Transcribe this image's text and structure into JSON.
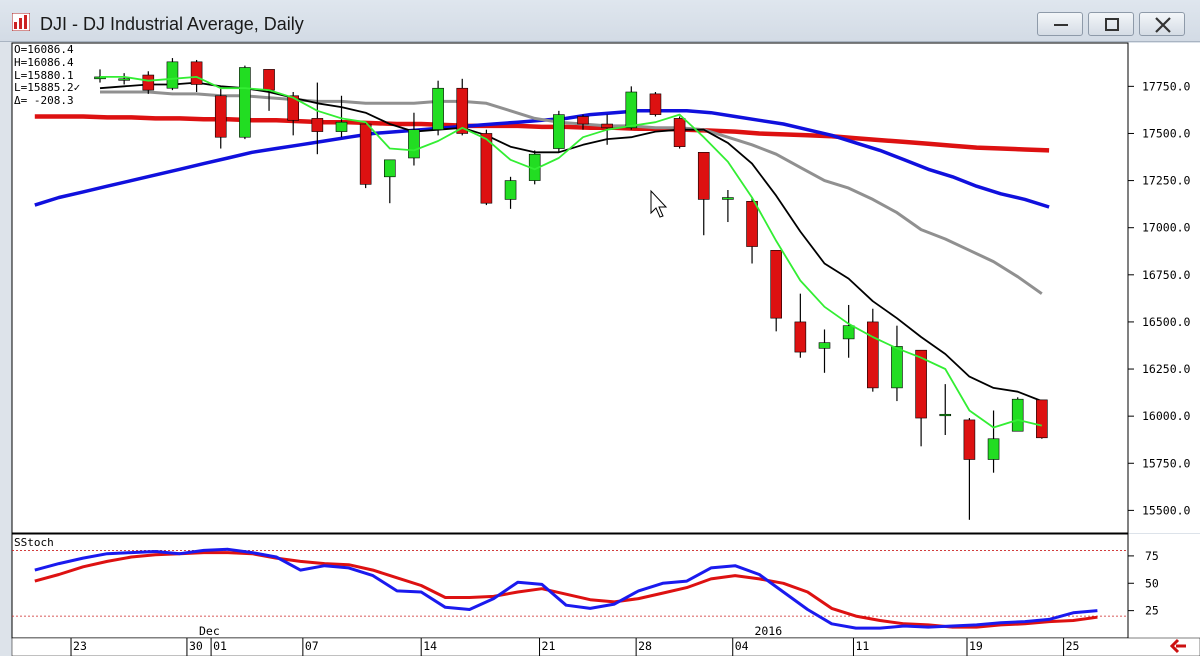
{
  "window": {
    "title": "DJI - DJ Industrial Average, Daily",
    "minimize_icon": "minimize-icon",
    "maximize_icon": "maximize-icon",
    "close_icon": "close-icon"
  },
  "ohlc_readout": {
    "open": "O=16086.4",
    "high": "H=16086.4",
    "low": "L=15880.1",
    "last": "L=15885.2",
    "last_mark": "✓",
    "delta": "Δ= -208.3"
  },
  "colors": {
    "up_candle": "#22dd22",
    "down_candle": "#dd1111",
    "ma_fast": "#33ee33",
    "ma_black": "#000000",
    "ma_gray": "#909090",
    "ma_blue": "#1010dd",
    "ma_red": "#dd1111",
    "stoch_k": "#1a1aee",
    "stoch_d": "#dd1111",
    "ref_line": "#cc2222"
  },
  "chart_data": [
    {
      "type": "candlestick",
      "title": "DJI - DJ Industrial Average, Daily",
      "price_axis": {
        "ylim": [
          15380,
          17980
        ],
        "ticks": [
          17750,
          17500,
          17250,
          17000,
          16750,
          16500,
          16250,
          16000,
          15750,
          15500
        ],
        "tick_labels": [
          "17750.0",
          "17500.0",
          "17250.0",
          "17000.0",
          "16750.0",
          "16500.0",
          "16250.0",
          "16000.0",
          "15750.0",
          "15500.0"
        ]
      },
      "date_axis": {
        "labels": [
          {
            "text": "23",
            "i": -1.2
          },
          {
            "text": "30",
            "i": 3.6
          },
          {
            "text": "01",
            "i": 4.6
          },
          {
            "text": "07",
            "i": 8.4
          },
          {
            "text": "14",
            "i": 13.3
          },
          {
            "text": "21",
            "i": 18.2
          },
          {
            "text": "28",
            "i": 22.2
          },
          {
            "text": "04",
            "i": 26.2
          },
          {
            "text": "11",
            "i": 31.2
          },
          {
            "text": "19",
            "i": 35.9
          },
          {
            "text": "25",
            "i": 39.9
          }
        ],
        "group_labels": [
          {
            "text": "Dec",
            "i": 4.1
          },
          {
            "text": "2016",
            "i": 27.1
          }
        ]
      },
      "candles": [
        {
          "o": 17790,
          "h": 17840,
          "l": 17770,
          "c": 17800
        },
        {
          "o": 17790,
          "h": 17820,
          "l": 17760,
          "c": 17790
        },
        {
          "o": 17810,
          "h": 17830,
          "l": 17710,
          "c": 17730
        },
        {
          "o": 17740,
          "h": 17900,
          "l": 17730,
          "c": 17880
        },
        {
          "o": 17880,
          "h": 17890,
          "l": 17720,
          "c": 17760
        },
        {
          "o": 17700,
          "h": 17750,
          "l": 17420,
          "c": 17480
        },
        {
          "o": 17480,
          "h": 17860,
          "l": 17470,
          "c": 17850
        },
        {
          "o": 17840,
          "h": 17840,
          "l": 17620,
          "c": 17730
        },
        {
          "o": 17700,
          "h": 17720,
          "l": 17490,
          "c": 17570
        },
        {
          "o": 17580,
          "h": 17770,
          "l": 17390,
          "c": 17510
        },
        {
          "o": 17510,
          "h": 17700,
          "l": 17480,
          "c": 17560
        },
        {
          "o": 17550,
          "h": 17560,
          "l": 17210,
          "c": 17230
        },
        {
          "o": 17270,
          "h": 17360,
          "l": 17130,
          "c": 17360
        },
        {
          "o": 17370,
          "h": 17610,
          "l": 17330,
          "c": 17520
        },
        {
          "o": 17520,
          "h": 17780,
          "l": 17490,
          "c": 17740
        },
        {
          "o": 17740,
          "h": 17790,
          "l": 17490,
          "c": 17500
        },
        {
          "o": 17500,
          "h": 17520,
          "l": 17120,
          "c": 17130
        },
        {
          "o": 17150,
          "h": 17270,
          "l": 17100,
          "c": 17250
        },
        {
          "o": 17250,
          "h": 17410,
          "l": 17230,
          "c": 17390
        },
        {
          "o": 17420,
          "h": 17620,
          "l": 17400,
          "c": 17600
        },
        {
          "o": 17590,
          "h": 17600,
          "l": 17520,
          "c": 17550
        },
        {
          "o": 17550,
          "h": 17600,
          "l": 17440,
          "c": 17530
        },
        {
          "o": 17530,
          "h": 17750,
          "l": 17520,
          "c": 17720
        },
        {
          "o": 17710,
          "h": 17720,
          "l": 17590,
          "c": 17600
        },
        {
          "o": 17580,
          "h": 17590,
          "l": 17420,
          "c": 17430
        },
        {
          "o": 17400,
          "h": 17400,
          "l": 16960,
          "c": 17150
        },
        {
          "o": 17150,
          "h": 17200,
          "l": 17030,
          "c": 17160
        },
        {
          "o": 17140,
          "h": 17160,
          "l": 16810,
          "c": 16900
        },
        {
          "o": 16880,
          "h": 16880,
          "l": 16450,
          "c": 16520
        },
        {
          "o": 16500,
          "h": 16650,
          "l": 16310,
          "c": 16340
        },
        {
          "o": 16360,
          "h": 16460,
          "l": 16230,
          "c": 16390
        },
        {
          "o": 16410,
          "h": 16590,
          "l": 16310,
          "c": 16480
        },
        {
          "o": 16500,
          "h": 16570,
          "l": 16130,
          "c": 16150
        },
        {
          "o": 16150,
          "h": 16480,
          "l": 16080,
          "c": 16370
        },
        {
          "o": 16350,
          "h": 16350,
          "l": 15840,
          "c": 15990
        },
        {
          "o": 16010,
          "h": 16170,
          "l": 15900,
          "c": 16010
        },
        {
          "o": 15980,
          "h": 15990,
          "l": 15450,
          "c": 15770
        },
        {
          "o": 15770,
          "h": 16030,
          "l": 15700,
          "c": 15880
        },
        {
          "o": 15920,
          "h": 16100,
          "l": 15920,
          "c": 16090
        },
        {
          "o": 16086.4,
          "h": 16086.4,
          "l": 15880.1,
          "c": 15885.2
        }
      ],
      "moving_averages": [
        {
          "color": "ma_fast",
          "values": [
            17800,
            17800,
            17780,
            17790,
            17800,
            17740,
            17740,
            17730,
            17690,
            17620,
            17580,
            17560,
            17420,
            17410,
            17460,
            17530,
            17470,
            17360,
            17310,
            17370,
            17480,
            17520,
            17540,
            17560,
            17600,
            17480,
            17350,
            17160,
            16930,
            16720,
            16580,
            16490,
            16420,
            16360,
            16310,
            16250,
            16030,
            15940,
            15980,
            15950
          ]
        },
        {
          "color": "ma_black",
          "start": 0,
          "values": [
            17740,
            17750,
            17760,
            17760,
            17770,
            17750,
            17740,
            17720,
            17690,
            17660,
            17640,
            17610,
            17550,
            17510,
            17520,
            17530,
            17490,
            17430,
            17400,
            17400,
            17440,
            17470,
            17480,
            17510,
            17520,
            17520,
            17450,
            17340,
            17170,
            16980,
            16810,
            16730,
            16610,
            16520,
            16420,
            16330,
            16210,
            16150,
            16130,
            16080
          ]
        },
        {
          "color": "ma_gray",
          "values": [
            17720,
            17720,
            17720,
            17710,
            17710,
            17700,
            17700,
            17690,
            17680,
            17670,
            17670,
            17660,
            17660,
            17660,
            17670,
            17670,
            17660,
            17620,
            17580,
            17560,
            17550,
            17540,
            17540,
            17530,
            17530,
            17520,
            17480,
            17440,
            17390,
            17320,
            17250,
            17210,
            17150,
            17080,
            16990,
            16940,
            16880,
            16820,
            16740,
            16650
          ]
        },
        {
          "color": "ma_blue",
          "start": -2.7,
          "values": [
            17120,
            17160,
            17190,
            17220,
            17250,
            17280,
            17310,
            17340,
            17370,
            17400,
            17420,
            17440,
            17460,
            17480,
            17500,
            17510,
            17520,
            17530,
            17540,
            17550,
            17560,
            17570,
            17580,
            17600,
            17610,
            17620,
            17620,
            17620,
            17610,
            17590,
            17570,
            17550,
            17520,
            17490,
            17450,
            17410,
            17360,
            17310,
            17270,
            17220,
            17180,
            17150,
            17110
          ]
        },
        {
          "color": "ma_red",
          "start": -2.7,
          "values": [
            17590,
            17590,
            17590,
            17585,
            17585,
            17580,
            17580,
            17575,
            17575,
            17570,
            17570,
            17565,
            17560,
            17560,
            17555,
            17550,
            17550,
            17545,
            17540,
            17540,
            17540,
            17535,
            17535,
            17530,
            17530,
            17525,
            17525,
            17520,
            17515,
            17510,
            17500,
            17495,
            17490,
            17485,
            17475,
            17465,
            17455,
            17445,
            17435,
            17425,
            17420,
            17415,
            17410
          ]
        }
      ]
    },
    {
      "type": "line",
      "title": "SStoch",
      "ylim": [
        0,
        95
      ],
      "ticks": [
        75,
        50,
        25
      ],
      "reference_lines": [
        80,
        20
      ],
      "series": [
        {
          "color": "stoch_k",
          "start": -2.7,
          "values": [
            62,
            68,
            73,
            77,
            78,
            79,
            77,
            80,
            81,
            78,
            74,
            62,
            66,
            64,
            57,
            43,
            42,
            28,
            26,
            36,
            51,
            49,
            30,
            27,
            31,
            43,
            50,
            52,
            64,
            66,
            58,
            42,
            26,
            13,
            9,
            9,
            11,
            10,
            11,
            12,
            14,
            15,
            17,
            23,
            25
          ]
        },
        {
          "color": "stoch_d",
          "start": -2.7,
          "values": [
            52,
            58,
            65,
            70,
            74,
            76,
            77,
            78,
            78,
            77,
            73,
            70,
            68,
            67,
            62,
            55,
            48,
            37,
            37,
            38,
            42,
            45,
            40,
            35,
            33,
            36,
            41,
            46,
            54,
            57,
            54,
            50,
            42,
            27,
            20,
            16,
            13,
            12,
            10,
            10,
            12,
            13,
            15,
            16,
            19
          ]
        }
      ]
    }
  ]
}
